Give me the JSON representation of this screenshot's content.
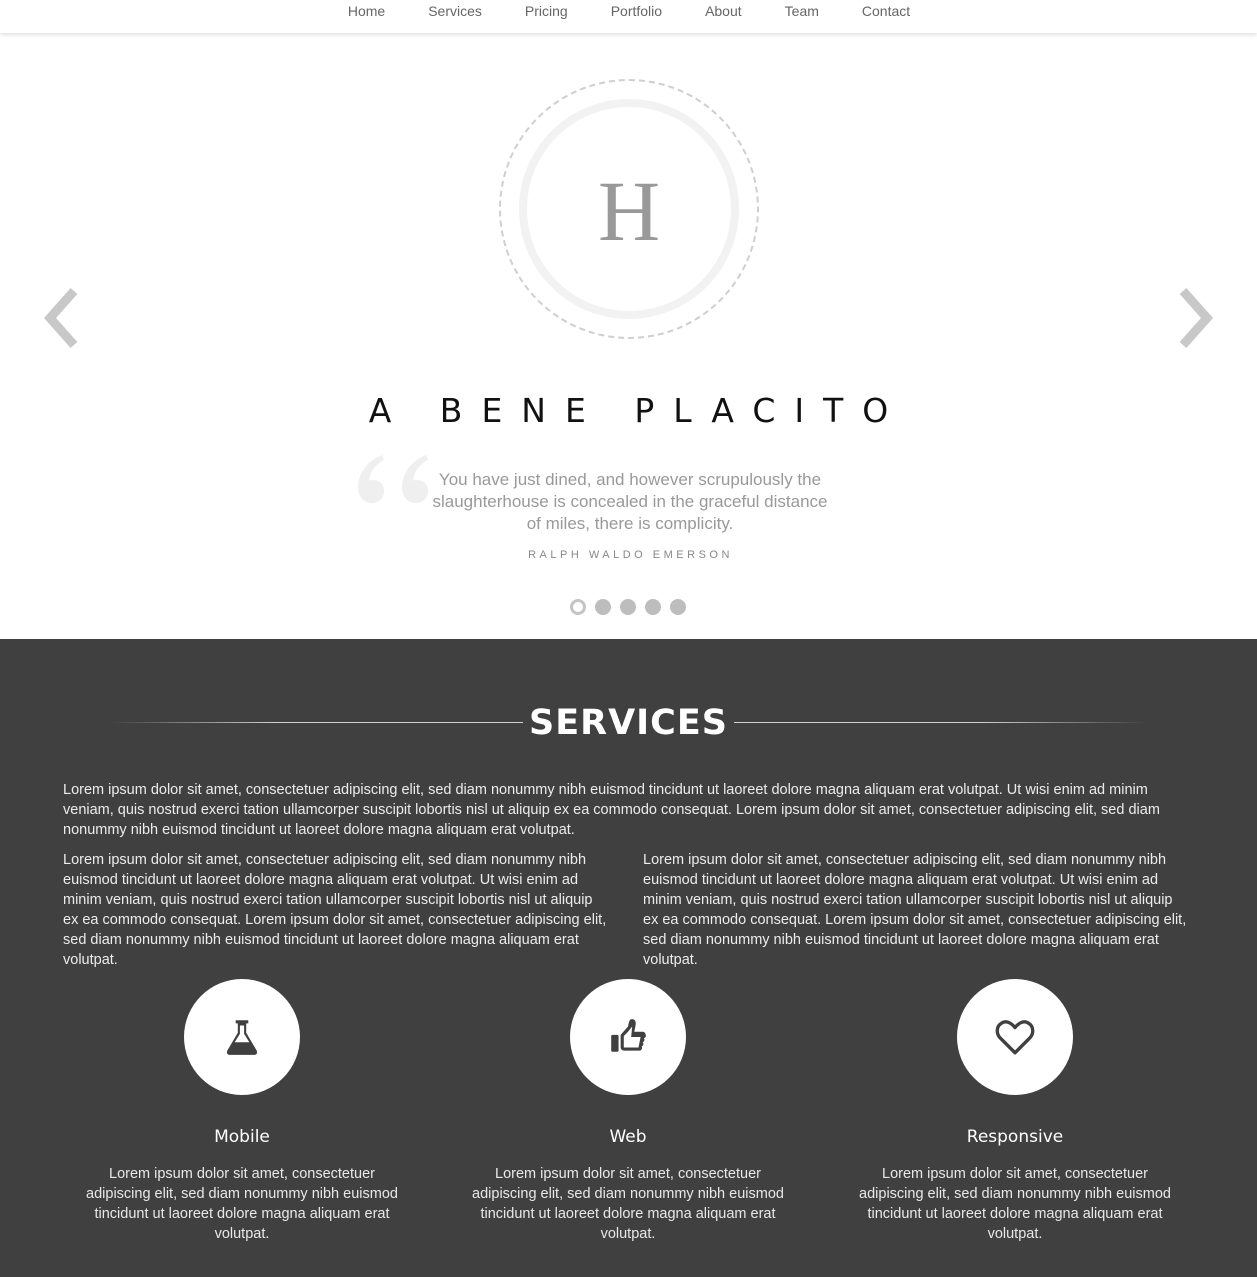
{
  "nav": {
    "items": [
      "Home",
      "Services",
      "Pricing",
      "Portfolio",
      "About",
      "Team",
      "Contact"
    ]
  },
  "hero": {
    "logo_letter": "H",
    "slide_title": "A BENE PLACITO",
    "quote": "You have just dined, and however scrupulously the slaughterhouse is concealed in the graceful distance of miles, there is complicity.",
    "author": "RALPH WALDO EMERSON",
    "slide_count": 5,
    "active_slide": 1,
    "prev_icon": "chevron-left-icon",
    "next_icon": "chevron-right-icon"
  },
  "services": {
    "title": "SERVICES",
    "intro": "Lorem ipsum dolor sit amet, consectetuer adipiscing elit, sed diam nonummy nibh euismod tincidunt ut laoreet dolore magna aliquam erat volutpat. Ut wisi enim ad minim veniam, quis nostrud exerci tation ullamcorper suscipit lobortis nisl ut aliquip ex ea commodo consequat. Lorem ipsum dolor sit amet, consectetuer adipiscing elit, sed diam nonummy nibh euismod tincidunt ut laoreet dolore magna aliquam erat volutpat.",
    "col_left": "Lorem ipsum dolor sit amet, consectetuer adipiscing elit, sed diam nonummy nibh euismod tincidunt ut laoreet dolore magna aliquam erat volutpat. Ut wisi enim ad minim veniam, quis nostrud exerci tation ullamcorper suscipit lobortis nisl ut aliquip ex ea commodo consequat. Lorem ipsum dolor sit amet, consectetuer adipiscing elit, sed diam nonummy nibh euismod tincidunt ut laoreet dolore magna aliquam erat volutpat.",
    "col_right": "Lorem ipsum dolor sit amet, consectetuer adipiscing elit, sed diam nonummy nibh euismod tincidunt ut laoreet dolore magna aliquam erat volutpat. Ut wisi enim ad minim veniam, quis nostrud exerci tation ullamcorper suscipit lobortis nisl ut aliquip ex ea commodo consequat. Lorem ipsum dolor sit amet, consectetuer adipiscing elit, sed diam nonummy nibh euismod tincidunt ut laoreet dolore magna aliquam erat volutpat.",
    "features": [
      {
        "icon": "flask-icon",
        "title": "Mobile",
        "text": "Lorem ipsum dolor sit amet, consectetuer adipiscing elit, sed diam nonummy nibh euismod tincidunt ut laoreet dolore magna aliquam erat volutpat."
      },
      {
        "icon": "thumbs-up-icon",
        "title": "Web",
        "text": "Lorem ipsum dolor sit amet, consectetuer adipiscing elit, sed diam nonummy nibh euismod tincidunt ut laoreet dolore magna aliquam erat volutpat."
      },
      {
        "icon": "heart-icon",
        "title": "Responsive",
        "text": "Lorem ipsum dolor sit amet, consectetuer adipiscing elit, sed diam nonummy nibh euismod tincidunt ut laoreet dolore magna aliquam erat volutpat."
      }
    ]
  },
  "colors": {
    "services_bg": "#404040",
    "icon": "#404040",
    "dot": "#bdbdbd"
  }
}
